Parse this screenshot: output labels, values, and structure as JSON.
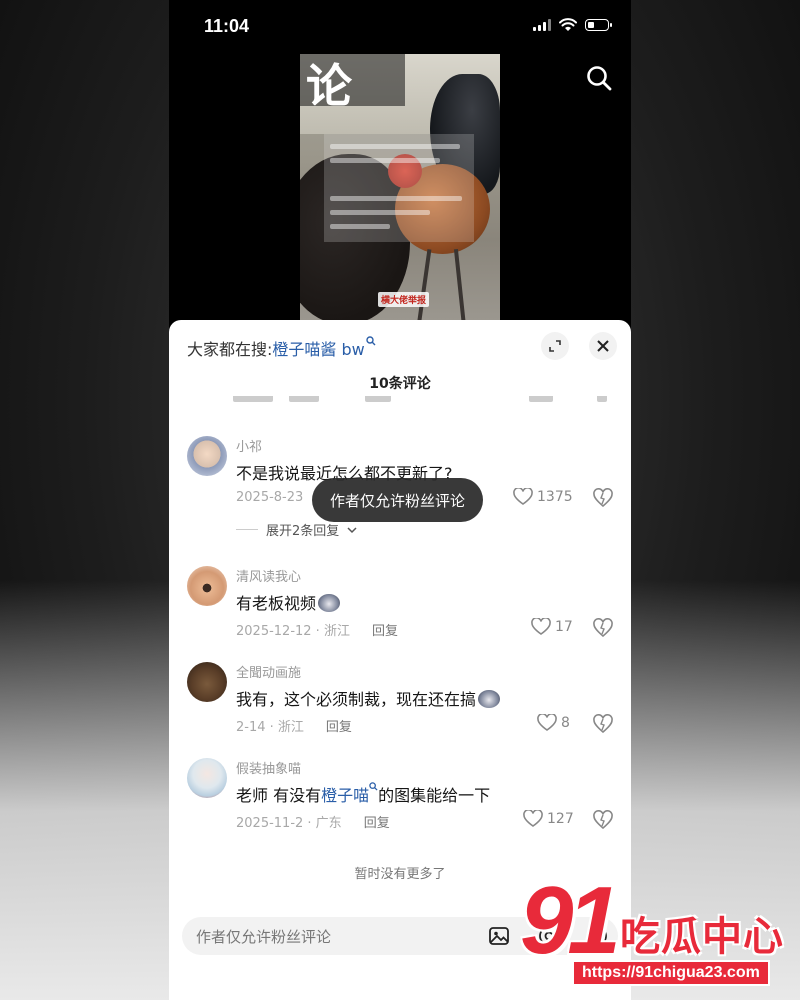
{
  "status_bar": {
    "time": "11:04"
  },
  "video": {
    "caption": "横大佬举报",
    "overlay_glyph": "论"
  },
  "sheet": {
    "hot_search_prefix": "大家都在搜:",
    "hot_search_term": "橙子喵酱 bw",
    "comment_count": "10条评论",
    "toast": "作者仅允许粉丝评论",
    "no_more": "暂时没有更多了",
    "input_placeholder": "作者仅允许粉丝评论"
  },
  "comments": [
    {
      "username": "小祁",
      "text": "不是我说最近怎么都不更新了?",
      "date_region": "2025-8-23",
      "reply_label": "回复",
      "likes": "1375",
      "expand_label": "展开2条回复"
    },
    {
      "username": "清风读我心",
      "text": "有老板视频",
      "date_region": "2025-12-12 · 浙江",
      "reply_label": "回复",
      "likes": "17"
    },
    {
      "username": "全聞动画施",
      "text": "我有，这个必须制裁，现在还在搞",
      "date_region": "2-14 · 浙江",
      "reply_label": "回复",
      "likes": "8"
    },
    {
      "username": "假装抽象喵",
      "text_before": "老师 有没有",
      "text_link": "橙子喵",
      "text_after": "的图集能给一下",
      "date_region": "2025-11-2 · 广东",
      "reply_label": "回复",
      "likes": "127"
    }
  ],
  "watermark": {
    "number": "91",
    "name": "吃瓜中心",
    "url": "https://91chigua23.com"
  },
  "colors": {
    "link": "#2a5ea8",
    "watermark_red": "#e82a3a",
    "sheet_bg": "#ffffff"
  }
}
